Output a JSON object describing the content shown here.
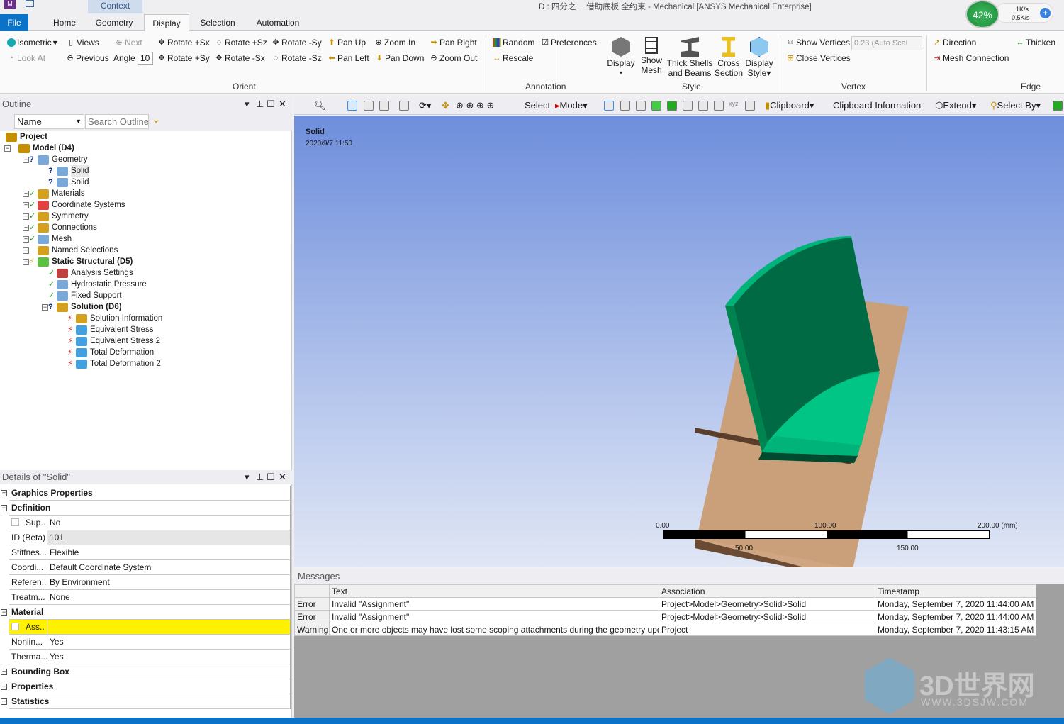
{
  "window": {
    "title": "D : 四分之一 借助底板 全约束 - Mechanical [ANSYS Mechanical Enterprise]",
    "context_tab": "Context",
    "gauge": "42%",
    "net_up": "1K/s",
    "net_down": "0.5K/s"
  },
  "tabs": [
    {
      "label": "File"
    },
    {
      "label": "Home"
    },
    {
      "label": "Geometry"
    },
    {
      "label": "Display"
    },
    {
      "label": "Selection"
    },
    {
      "label": "Automation"
    }
  ],
  "ribbon": {
    "orient": {
      "label": "Orient",
      "isometric": "Isometric",
      "views": "Views",
      "next": "Next",
      "look_at": "Look At",
      "previous": "Previous",
      "angle_label": "Angle",
      "angle_value": "10",
      "rotate_psx": "Rotate +Sx",
      "rotate_psy": "Rotate +Sy",
      "rotate_psz": "Rotate +Sz",
      "rotate_msx": "Rotate -Sx",
      "rotate_msy": "Rotate -Sy",
      "rotate_msz": "Rotate -Sz",
      "pan_up": "Pan Up",
      "pan_left": "Pan Left",
      "pan_down": "Pan Down",
      "pan_right": "Pan Right",
      "zoom_in": "Zoom In",
      "zoom_out": "Zoom Out"
    },
    "annotation": {
      "label": "Annotation",
      "random": "Random",
      "preferences": "Preferences",
      "rescale": "Rescale"
    },
    "style": {
      "label": "Style",
      "display": "Display",
      "show_mesh": [
        "Show",
        "Mesh"
      ],
      "thick": [
        "Thick Shells",
        "and Beams"
      ],
      "cross": [
        "Cross",
        "Section"
      ],
      "display_style": [
        "Display",
        "Style"
      ]
    },
    "vertex": {
      "label": "Vertex",
      "show_vertices": "Show Vertices",
      "scale_value": "0.23 (Auto Scal",
      "close_vertices": "Close Vertices"
    },
    "edge": {
      "label": "Edge",
      "direction": "Direction",
      "thicken": "Thicken",
      "mesh_connection": "Mesh Connection"
    }
  },
  "toolbar": {
    "select": "Select",
    "mode": "Mode",
    "clipboard": "Clipboard",
    "clipboard_info": "Clipboard Information",
    "extend": "Extend",
    "select_by": "Select By"
  },
  "outline": {
    "title": "Outline",
    "name_filter": "Name",
    "search_placeholder": "Search Outline",
    "items": [
      {
        "label": "Project",
        "bold": true
      },
      {
        "label": "Model (D4)",
        "bold": true
      },
      {
        "label": "Geometry"
      },
      {
        "label": "Solid"
      },
      {
        "label": "Solid"
      },
      {
        "label": "Materials"
      },
      {
        "label": "Coordinate Systems"
      },
      {
        "label": "Symmetry"
      },
      {
        "label": "Connections"
      },
      {
        "label": "Mesh"
      },
      {
        "label": "Named Selections"
      },
      {
        "label": "Static Structural (D5)",
        "bold": true
      },
      {
        "label": "Analysis Settings"
      },
      {
        "label": "Hydrostatic Pressure"
      },
      {
        "label": "Fixed Support"
      },
      {
        "label": "Solution (D6)",
        "bold": true
      },
      {
        "label": "Solution Information"
      },
      {
        "label": "Equivalent Stress"
      },
      {
        "label": "Equivalent Stress 2"
      },
      {
        "label": "Total Deformation"
      },
      {
        "label": "Total Deformation 2"
      }
    ]
  },
  "details": {
    "title": "Details of \"Solid\"",
    "rows": [
      {
        "section": "Graphics Properties"
      },
      {
        "section": "Definition"
      },
      {
        "key": "Sup...",
        "value": "No"
      },
      {
        "key": "ID (Beta)",
        "value": "101"
      },
      {
        "key": "Stiffnes...",
        "value": "Flexible"
      },
      {
        "key": "Coordi...",
        "value": "Default Coordinate System"
      },
      {
        "key": "Referen...",
        "value": "By Environment"
      },
      {
        "key": "Treatm...",
        "value": "None"
      },
      {
        "section": "Material"
      },
      {
        "key": "Ass...",
        "value": ""
      },
      {
        "key": "Nonlin...",
        "value": "Yes"
      },
      {
        "key": "Therma...",
        "value": "Yes"
      },
      {
        "section": "Bounding Box"
      },
      {
        "section": "Properties"
      },
      {
        "section": "Statistics"
      }
    ]
  },
  "viewport": {
    "label": "Solid",
    "date": "2020/9/7 11:50",
    "scale": {
      "t0": "0.00",
      "t100": "100.00",
      "t200": "200.00 (mm)",
      "t50": "50.00",
      "t150": "150.00"
    },
    "colors": {
      "background_top": "#6e8edc",
      "part": "#00c080",
      "plate": "#c9a07a"
    }
  },
  "messages": {
    "title": "Messages",
    "headers": [
      "",
      "Text",
      "Association",
      "Timestamp"
    ],
    "rows": [
      [
        "Error",
        "Invalid \"Assignment\"",
        "Project>Model>Geometry>Solid>Solid",
        "Monday, September 7, 2020 11:44:00 AM"
      ],
      [
        "Error",
        "Invalid \"Assignment\"",
        "Project>Model>Geometry>Solid>Solid",
        "Monday, September 7, 2020 11:44:00 AM"
      ],
      [
        "Warning",
        "One or more objects may have lost some scoping attachments during the geometry upd",
        "Project",
        "Monday, September 7, 2020 11:43:15 AM"
      ]
    ]
  },
  "watermark": {
    "brand": "3D世界网",
    "url": "WWW.3DSJW.COM"
  }
}
